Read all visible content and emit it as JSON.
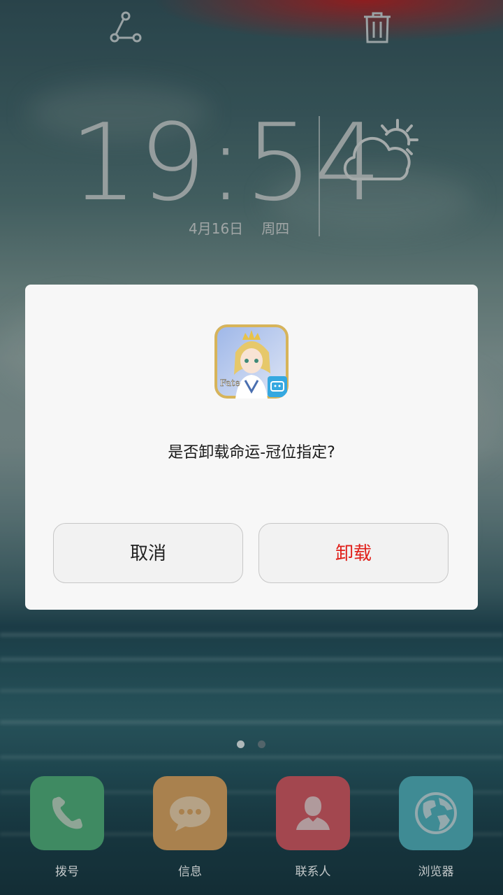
{
  "top_bar": {
    "left_icon": "share-icon",
    "right_icon": "trash-icon"
  },
  "clock": {
    "time": "19:54",
    "date": "4月16日",
    "weekday": "周四",
    "weather_icon": "partly-cloudy-icon"
  },
  "dialog": {
    "app_icon": "fate-grand-order-app-icon",
    "message": "是否卸载命运-冠位指定?",
    "cancel_label": "取消",
    "uninstall_label": "卸载",
    "uninstall_color": "#e0201a"
  },
  "pager": {
    "pages": 2,
    "current": 1
  },
  "dock": [
    {
      "label": "拨号",
      "icon": "phone-icon",
      "color": "#3f8a62"
    },
    {
      "label": "信息",
      "icon": "message-bubble-icon",
      "color": "#a9814e"
    },
    {
      "label": "联系人",
      "icon": "person-icon",
      "color": "#a3474f"
    },
    {
      "label": "浏览器",
      "icon": "globe-icon",
      "color": "#3f8b94"
    }
  ]
}
